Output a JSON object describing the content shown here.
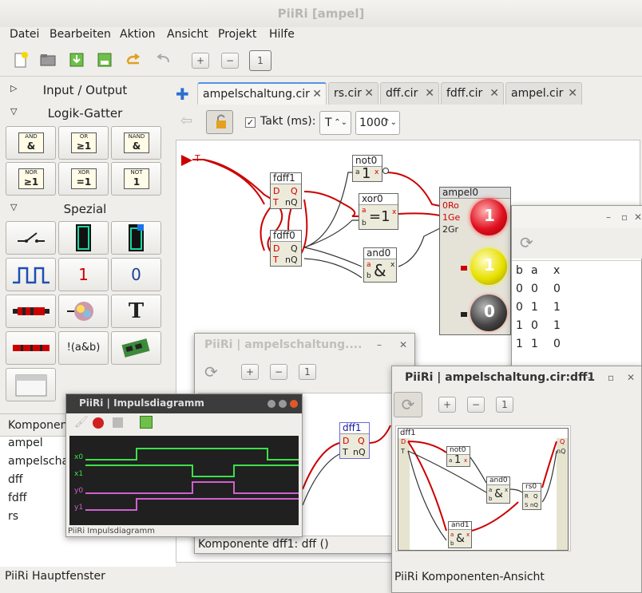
{
  "window": {
    "title": "PiiRi [ampel]",
    "status": "PiiRi Hauptfenster"
  },
  "menu": [
    "Datei",
    "Bearbeiten",
    "Aktion",
    "Ansicht",
    "Projekt",
    "Hilfe"
  ],
  "toolbar_icons": [
    "new-file-icon",
    "open-folder-icon",
    "save-icon",
    "save-as-icon",
    "redo-icon",
    "undo-icon",
    "zoom-in-icon",
    "zoom-out-icon",
    "zoom-fit-icon"
  ],
  "library": {
    "categories": [
      {
        "label": "Input / Output",
        "expanded": false
      },
      {
        "label": "Logik-Gatter",
        "expanded": true
      },
      {
        "label": "Spezial",
        "expanded": true
      }
    ],
    "gates": [
      {
        "name": "AND",
        "symbol": "&"
      },
      {
        "name": "OR",
        "symbol": "≥1"
      },
      {
        "name": "NAND",
        "symbol": "&"
      },
      {
        "name": "NOR",
        "symbol": "≥1"
      },
      {
        "name": "XOR",
        "symbol": "=1"
      },
      {
        "name": "NOT",
        "symbol": "1"
      }
    ],
    "special_labels": {
      "one": "1",
      "zero": "0",
      "text": "T",
      "expr": "!(a&b)"
    }
  },
  "components_panel": {
    "header": "Komponente",
    "items": [
      "ampel",
      "ampelschaltung",
      "dff",
      "fdff",
      "rs"
    ]
  },
  "tabs": [
    {
      "label": "ampelschaltung.cir",
      "active": true
    },
    {
      "label": "rs.cir",
      "active": false
    },
    {
      "label": "dff.cir",
      "active": false
    },
    {
      "label": "fdff.cir",
      "active": false
    },
    {
      "label": "ampel.cir",
      "active": false
    }
  ],
  "editor_toolbar": {
    "takt_label": "Takt (ms):",
    "takt_checked": true,
    "key_value": "T",
    "interval_value": "1000"
  },
  "circuit": {
    "input_label": "T",
    "fdff1": {
      "title": "fdff1",
      "in": [
        "D",
        "T"
      ],
      "out": [
        "Q",
        "nQ"
      ]
    },
    "fdff0": {
      "title": "fdff0",
      "in": [
        "D",
        "T"
      ],
      "out": [
        "Q",
        "nQ"
      ]
    },
    "not0": {
      "title": "not0",
      "in": "a",
      "symbol": "1",
      "out": "x"
    },
    "xor0": {
      "title": "xor0",
      "in": [
        "a",
        "b"
      ],
      "symbol": "=1",
      "out": "x"
    },
    "and0": {
      "title": "and0",
      "in": [
        "a",
        "b"
      ],
      "symbol": "&",
      "out": "x"
    },
    "ampel0": {
      "title": "ampel0",
      "inputs": [
        "0Ro",
        "1Ge",
        "2Gr"
      ],
      "lights": [
        "1",
        "1",
        "0"
      ]
    }
  },
  "truth_table": {
    "headers": [
      "b",
      "a",
      "x"
    ],
    "rows": [
      [
        "0",
        "0",
        "0"
      ],
      [
        "0",
        "1",
        "1"
      ],
      [
        "1",
        "0",
        "1"
      ],
      [
        "1",
        "1",
        "0"
      ]
    ]
  },
  "dff_window": {
    "title": "PiiRi | ampelschaltung....",
    "comp_title": "dff1",
    "in": [
      "D",
      "T"
    ],
    "out": [
      "Q",
      "nQ"
    ],
    "status": "Komponente dff1: dff ()"
  },
  "pulse_window": {
    "title": "PiiRi | Impulsdiagramm",
    "signals": [
      "x0",
      "x1",
      "y0",
      "y1"
    ],
    "status": "PiiRi Impulsdiagramm"
  },
  "comp_view_window": {
    "title": "PiiRi | ampelschaltung.cir:dff1",
    "inner_title": "dff1",
    "ports_left": [
      "D",
      "T"
    ],
    "ports_right": [
      "Q",
      "nQ"
    ],
    "not1": {
      "title": "not0",
      "in": "a",
      "symbol": "1",
      "out": "x"
    },
    "and0": {
      "title": "and0",
      "in": [
        "a",
        "b"
      ],
      "symbol": "&",
      "out": "x"
    },
    "rs0": {
      "title": "rs0",
      "in": [
        "R",
        "S"
      ],
      "out": [
        "Q",
        "nQ"
      ]
    },
    "and1": {
      "title": "and1",
      "in": [
        "a",
        "b"
      ],
      "symbol": "&",
      "out": "x"
    },
    "status": "PiiRi Komponenten-Ansicht"
  }
}
